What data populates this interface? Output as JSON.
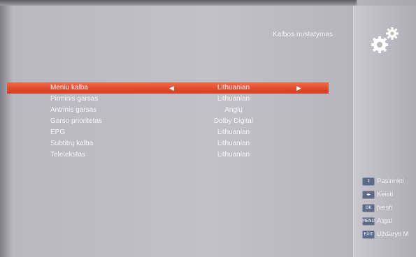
{
  "header": {
    "title": "Kalbos nustatymas",
    "icon": "gear-icon"
  },
  "menu": {
    "rows": [
      {
        "label": "Meniu kalba",
        "value": "Lithuanian",
        "selected": true
      },
      {
        "label": "Pirminis garsas",
        "value": "Lithuanian"
      },
      {
        "label": "Antrinis garsas",
        "value": "Anglų"
      },
      {
        "label": "Garso prioritetas",
        "value": "Dolby Digital"
      },
      {
        "label": "EPG",
        "value": "Lithuanian"
      },
      {
        "label": "Subtitrų kalba",
        "value": "Lithuanian"
      },
      {
        "label": "Teletekstas",
        "value": "Lithuanian"
      }
    ]
  },
  "hints": [
    {
      "key": "⇕",
      "label": "Pasirinkti"
    },
    {
      "key": "◂▸",
      "label": "Keisti"
    },
    {
      "key": "OK",
      "label": "Įvesti"
    },
    {
      "key": "MENU",
      "label": "Atgal"
    },
    {
      "key": "EXIT",
      "label": "Uždaryti M"
    }
  ],
  "colors": {
    "highlight": "#e24f30",
    "text": "#f7f7f9",
    "key_bg": "#5f6b86"
  }
}
